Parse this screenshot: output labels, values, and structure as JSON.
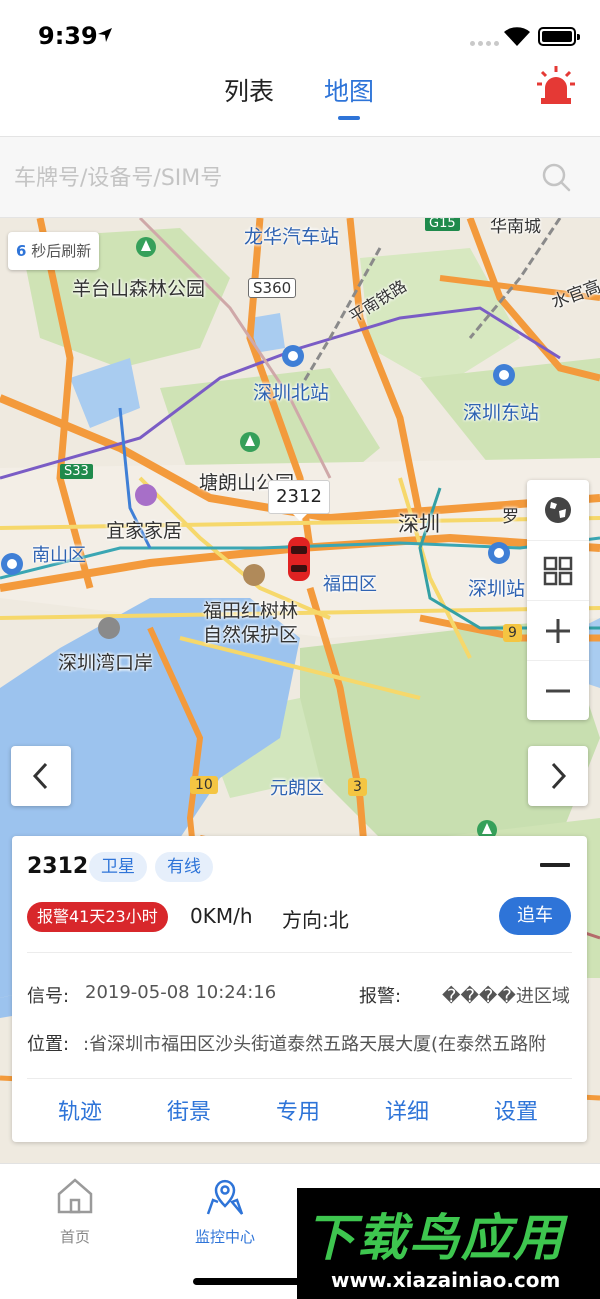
{
  "status_bar": {
    "time": "9:39"
  },
  "header": {
    "tabs": [
      {
        "label": "列表",
        "active": false
      },
      {
        "label": "地图",
        "active": true
      }
    ]
  },
  "search": {
    "placeholder": "车牌号/设备号/SIM号"
  },
  "map": {
    "refresh": {
      "seconds": "6",
      "text": "秒后刷新"
    },
    "labels": {
      "longhua_bus": "龙华汽车站",
      "hua_nan_cheng": "华南城",
      "yangtai": "羊台山森林公园",
      "s360": "S360",
      "pingnan_rail": "平南铁路",
      "shuiguan": "水官高",
      "shenzhen_north": "深圳北站",
      "shenzhen_east": "深圳东站",
      "s33": "S33",
      "tanglang": "塘朗山公园",
      "yijia": "宜家家居",
      "shenzhen": "深圳",
      "nanshan": "南山区",
      "futian": "福田区",
      "shenzhen_station": "深圳站",
      "futian_mangrove_1": "福田红树林",
      "futian_mangrove_2": "自然保护区",
      "bay_port": "深圳湾口岸",
      "yuanlang": "元朗区",
      "g15": "G15",
      "r9": "9",
      "r10": "10",
      "r3": "3",
      "luo": "罗"
    },
    "vehicle_label": "2312"
  },
  "card": {
    "plate": "2312",
    "tags": [
      "卫星",
      "有线"
    ],
    "alarm_badge": "报警41天23小时",
    "speed": "0KM/h",
    "direction": "方向:北",
    "chase_label": "追车",
    "signal_label": "信号:",
    "signal_value": "2019-05-08 10:24:16",
    "alarm_label": "报警:",
    "alarm_value": "����进区域",
    "position_label": "位置:",
    "position_value": ":省深圳市福田区沙头街道泰然五路天展大厦(在泰然五路附",
    "actions": [
      "轨迹",
      "街景",
      "专用",
      "详细",
      "设置"
    ]
  },
  "tabbar": {
    "items": [
      {
        "label": "首页",
        "active": false
      },
      {
        "label": "监控中心",
        "active": true
      }
    ]
  },
  "watermark": {
    "title": "下载鸟应用",
    "url": "www.xiazainiao.com"
  },
  "colors": {
    "accent": "#2e74d8",
    "alarm": "#d8272b",
    "watermark_green": "#3ec64f"
  }
}
